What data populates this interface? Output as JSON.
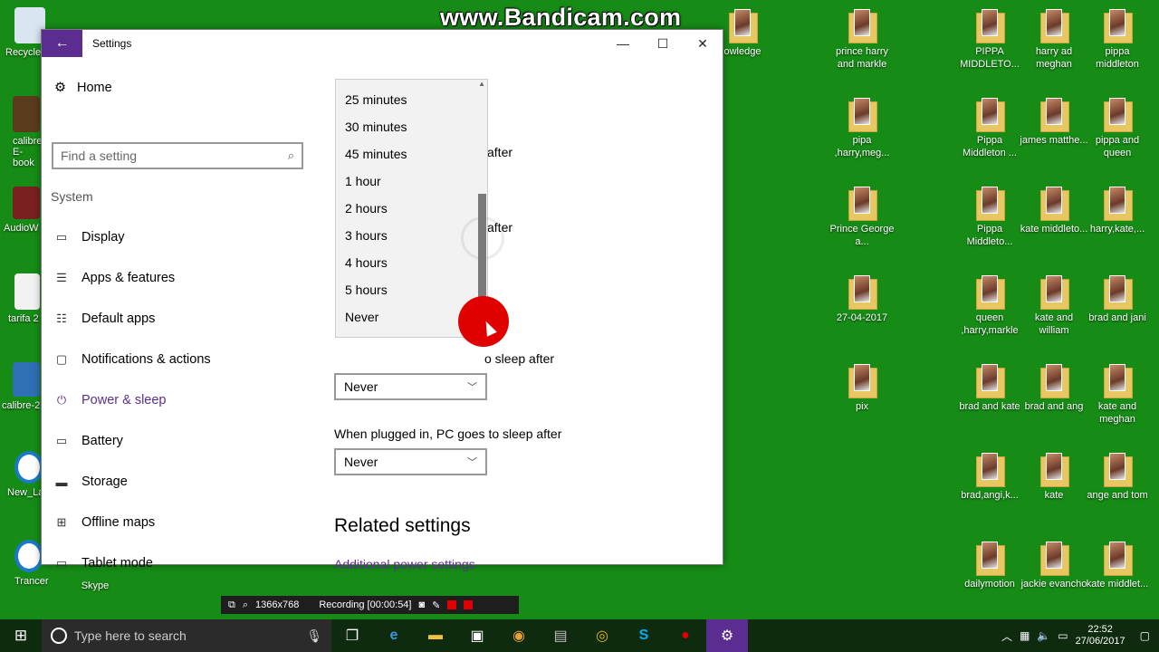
{
  "watermark": "www.Bandicam.com",
  "desktop": {
    "left_icons": [
      {
        "label": "Recycle"
      },
      {
        "label": "calibre E-book"
      },
      {
        "label": "AudioW"
      },
      {
        "label": "tarifa 2"
      },
      {
        "label": "calibre-2"
      },
      {
        "label": "New_La"
      },
      {
        "label": "Trancer"
      }
    ],
    "skype_label": "Skype",
    "knowledge_label": "owledge",
    "right_icons": [
      {
        "label": "prince harry and markle"
      },
      {
        "label": "PIPPA MIDDLETO..."
      },
      {
        "label": "harry ad meghan"
      },
      {
        "label": "pippa middleton"
      },
      {
        "label": "pipa ,harry,meg..."
      },
      {
        "label": "Pippa Middleton ..."
      },
      {
        "label": "james matthe..."
      },
      {
        "label": "pippa and queen"
      },
      {
        "label": "Prince George a..."
      },
      {
        "label": "Pippa Middleto..."
      },
      {
        "label": "kate middleto..."
      },
      {
        "label": "harry,kate,..."
      },
      {
        "label": "27-04-2017"
      },
      {
        "label": "queen ,harry,markle"
      },
      {
        "label": "kate and william"
      },
      {
        "label": "brad and jani"
      },
      {
        "label": "pix"
      },
      {
        "label": "brad and kate"
      },
      {
        "label": "brad and ang"
      },
      {
        "label": "kate and meghan"
      },
      {
        "label": "brad,angi,k..."
      },
      {
        "label": "kate"
      },
      {
        "label": "ange and tom"
      },
      {
        "label": "dailymotion"
      },
      {
        "label": "jackie evancho"
      },
      {
        "label": "kate middlet..."
      }
    ]
  },
  "window": {
    "title": "Settings",
    "controls": {
      "minimize": "—",
      "maximize": "☐",
      "close": "✕"
    },
    "back_glyph": "←"
  },
  "nav": {
    "home": "Home",
    "search_placeholder": "Find a setting",
    "section": "System",
    "items": [
      {
        "label": "Display",
        "icon": "monitor-icon",
        "glyph": "▭"
      },
      {
        "label": "Apps & features",
        "icon": "list-icon",
        "glyph": "☰"
      },
      {
        "label": "Default apps",
        "icon": "default-apps-icon",
        "glyph": "☷"
      },
      {
        "label": "Notifications & actions",
        "icon": "notification-icon",
        "glyph": "▢"
      },
      {
        "label": "Power & sleep",
        "icon": "power-icon",
        "glyph": "⏻"
      },
      {
        "label": "Battery",
        "icon": "battery-icon",
        "glyph": "▭"
      },
      {
        "label": "Storage",
        "icon": "storage-icon",
        "glyph": "▬"
      },
      {
        "label": "Offline maps",
        "icon": "map-icon",
        "glyph": "⊞"
      },
      {
        "label": "Tablet mode",
        "icon": "tablet-icon",
        "glyph": "▭"
      }
    ]
  },
  "content": {
    "partial_after_1": "after",
    "partial_after_2": "after",
    "battery_sleep_label_partial": "o sleep after",
    "battery_sleep_value": "Never",
    "plugged_sleep_label": "When plugged in, PC goes to sleep after",
    "plugged_sleep_value": "Never",
    "related_title": "Related settings",
    "related_link": "Additional power settings"
  },
  "popup": {
    "options": [
      "25 minutes",
      "30 minutes",
      "45 minutes",
      "1 hour",
      "2 hours",
      "3 hours",
      "4 hours",
      "5 hours",
      "Never"
    ]
  },
  "recording": {
    "resolution": "1366x768",
    "status": "Recording [00:00:54]"
  },
  "taskbar": {
    "search_placeholder": "Type here to search",
    "time": "22:52",
    "date": "27/06/2017"
  }
}
